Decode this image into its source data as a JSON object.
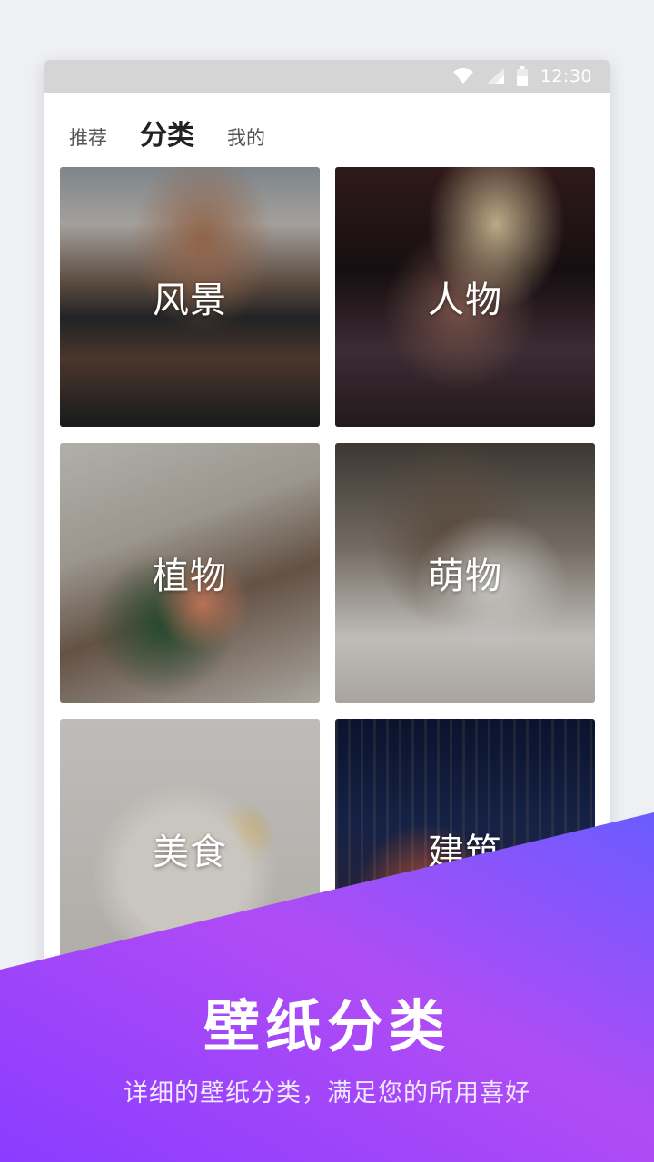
{
  "status_bar": {
    "time": "12:30",
    "icons": [
      "wifi-icon",
      "cellular-signal-icon",
      "battery-icon"
    ]
  },
  "tabs": [
    {
      "label": "推荐",
      "active": false
    },
    {
      "label": "分类",
      "active": true
    },
    {
      "label": "我的",
      "active": false
    }
  ],
  "categories": [
    {
      "label": "风景"
    },
    {
      "label": "人物"
    },
    {
      "label": "植物"
    },
    {
      "label": "萌物"
    },
    {
      "label": "美食"
    },
    {
      "label": "建筑"
    }
  ],
  "promo": {
    "title": "壁纸分类",
    "subtitle": "详细的壁纸分类，满足您的所用喜好",
    "gradient_colors": [
      "#8a3cff",
      "#b04cf5",
      "#6a5cff"
    ]
  },
  "colors": {
    "status_bar_bg": "#d5d5d5",
    "active_tab_text": "#222222",
    "inactive_tab_text": "#555555"
  }
}
